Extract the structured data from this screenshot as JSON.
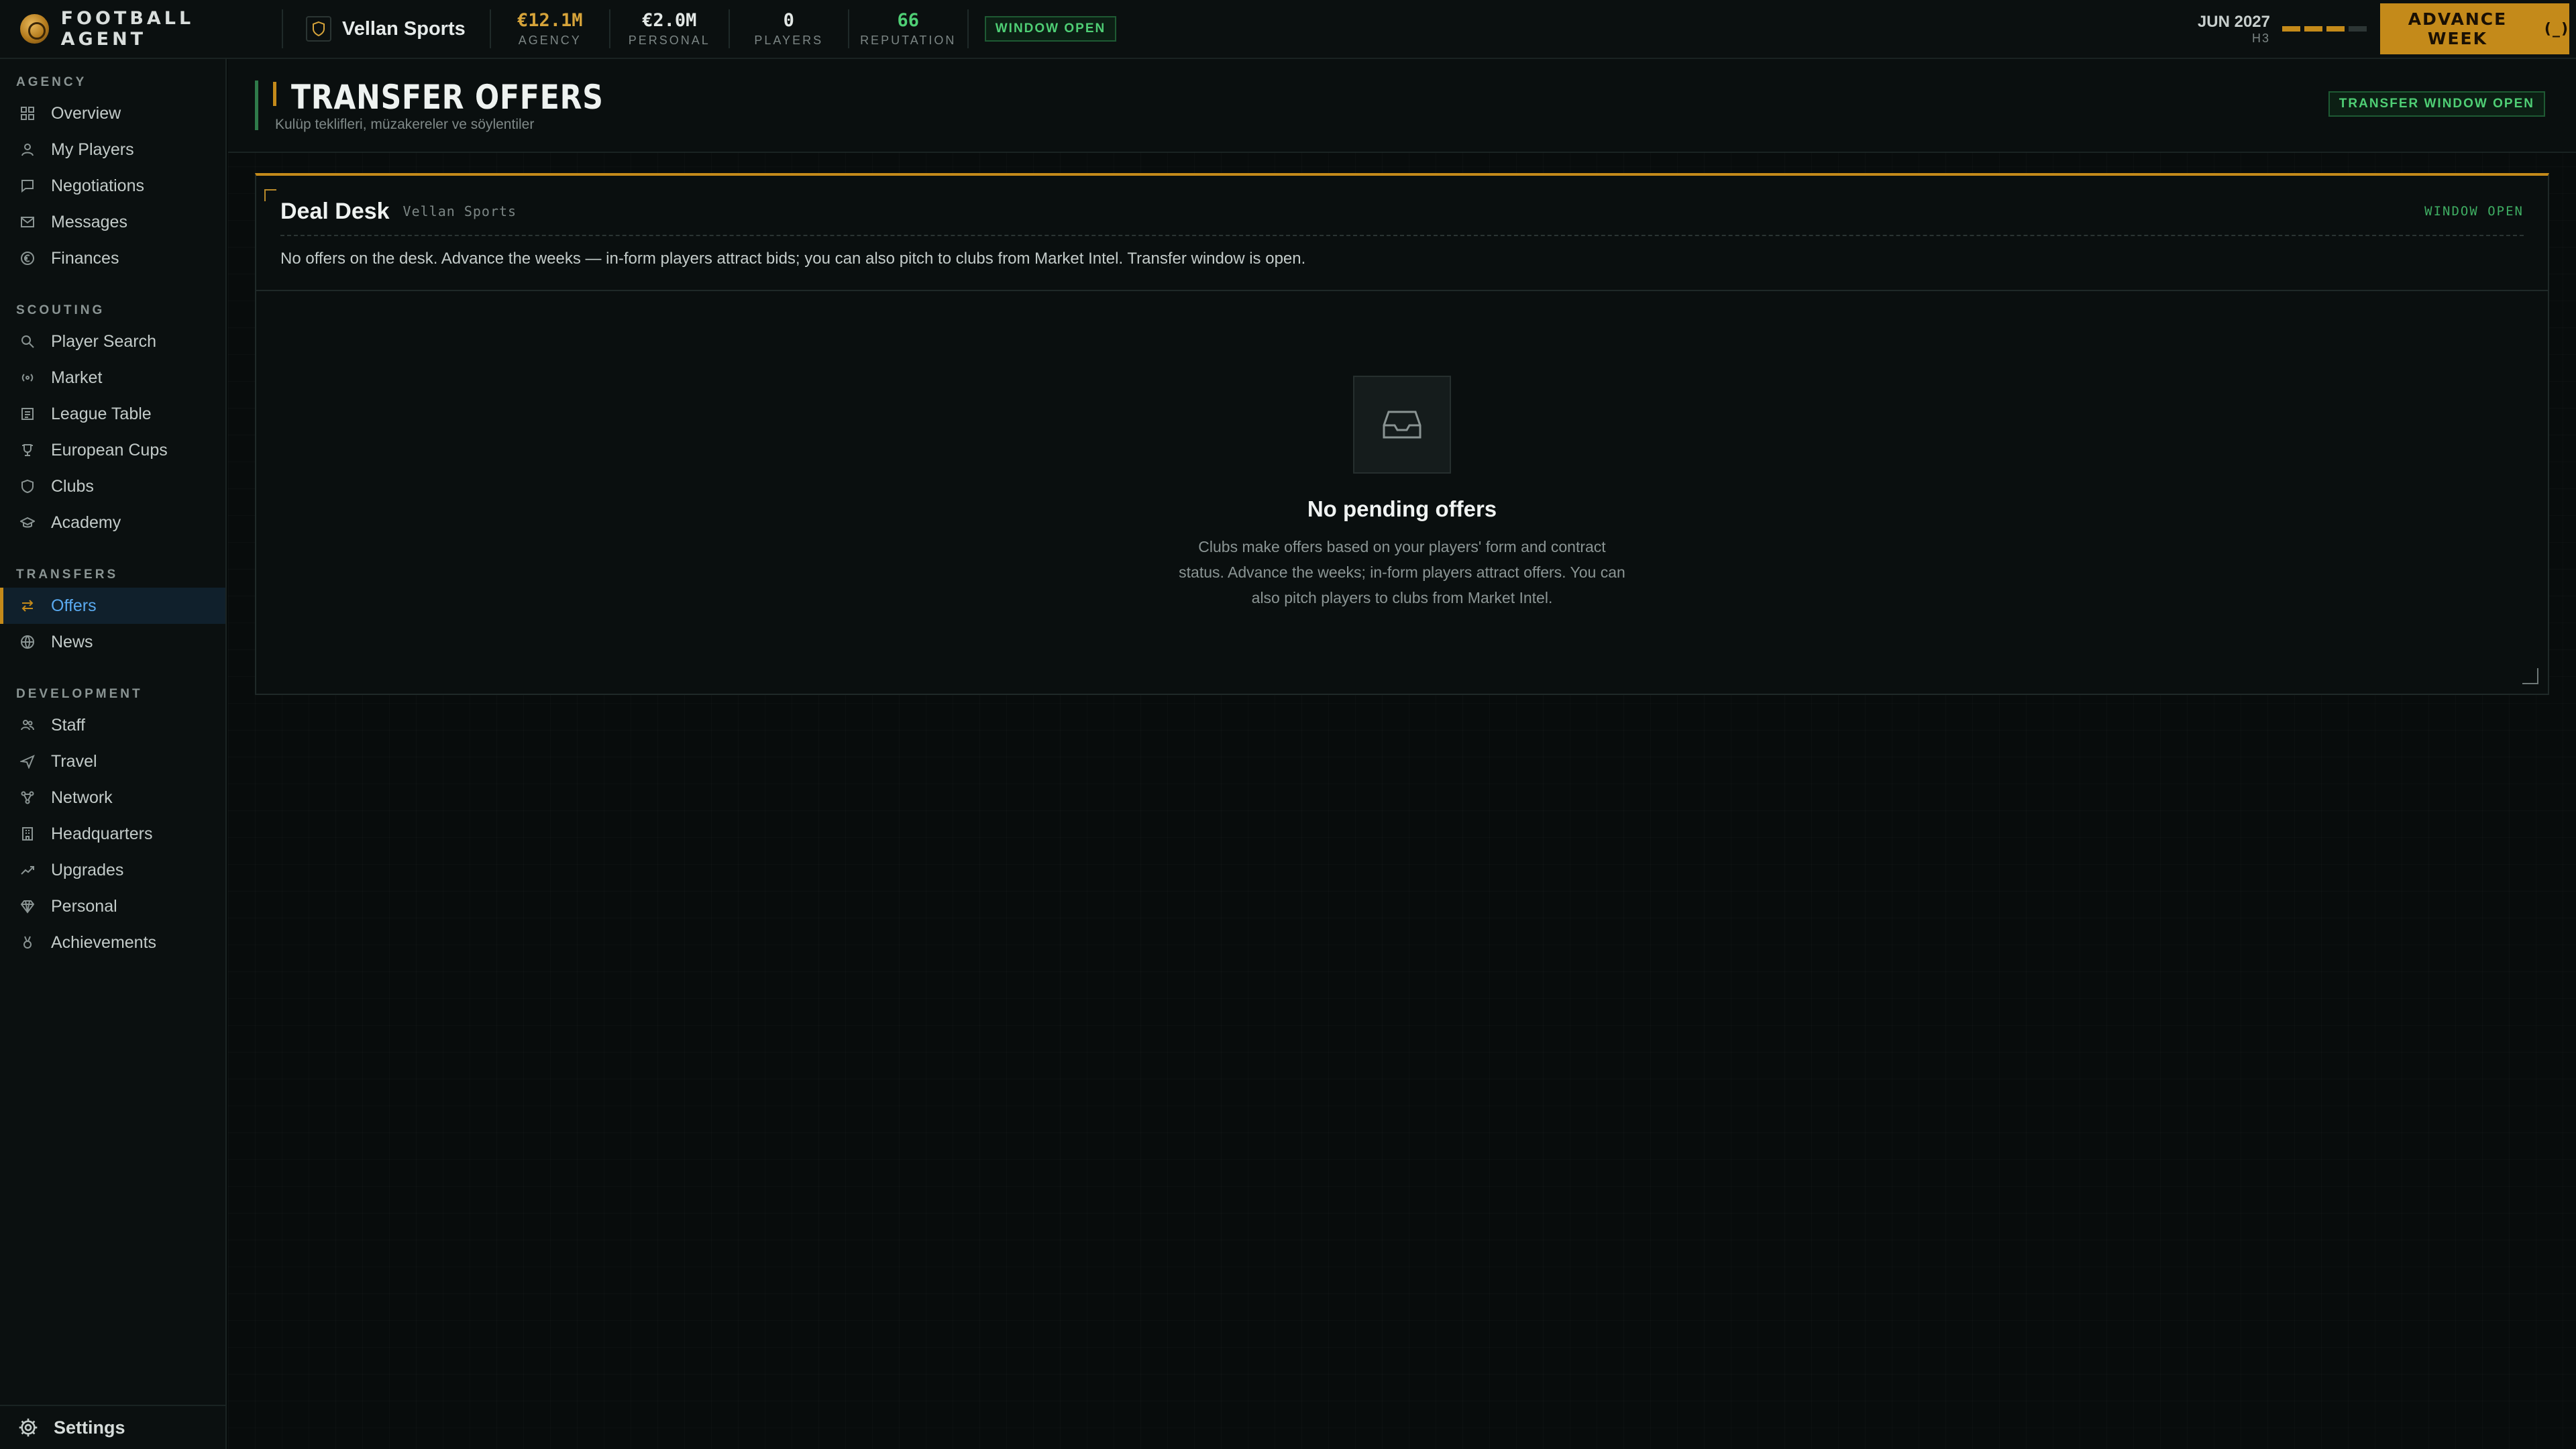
{
  "app": {
    "brand": "FOOTBALL AGENT",
    "club": "Vellan Sports"
  },
  "stats": [
    {
      "value": "€12.1M",
      "label": "AGENCY",
      "color": "#d7a43a"
    },
    {
      "value": "€2.0M",
      "label": "PERSONAL",
      "color": "#e3e8e6"
    },
    {
      "value": "0",
      "label": "PLAYERS",
      "color": "#e3e8e6"
    },
    {
      "value": "66",
      "label": "REPUTATION",
      "color": "#4fcf75"
    }
  ],
  "window_badge": "WINDOW OPEN",
  "date": {
    "main": "JUN 2027",
    "sub": "H3",
    "progress_filled": 3,
    "progress_total": 4
  },
  "advance": {
    "label": "ADVANCE WEEK",
    "shortcut": "(_)"
  },
  "sidebar": {
    "sections": [
      {
        "title": "AGENCY",
        "items": [
          {
            "label": "Overview",
            "icon": "grid-icon"
          },
          {
            "label": "My Players",
            "icon": "user-icon"
          },
          {
            "label": "Negotiations",
            "icon": "chat-icon"
          },
          {
            "label": "Messages",
            "icon": "mail-icon"
          },
          {
            "label": "Finances",
            "icon": "euro-icon"
          }
        ]
      },
      {
        "title": "SCOUTING",
        "items": [
          {
            "label": "Player Search",
            "icon": "search-icon"
          },
          {
            "label": "Market",
            "icon": "broadcast-icon"
          },
          {
            "label": "League Table",
            "icon": "table-icon"
          },
          {
            "label": "European Cups",
            "icon": "trophy-icon"
          },
          {
            "label": "Clubs",
            "icon": "shield-icon"
          },
          {
            "label": "Academy",
            "icon": "graduation-icon"
          }
        ]
      },
      {
        "title": "TRANSFERS",
        "items": [
          {
            "label": "Offers",
            "icon": "swap-icon",
            "active": true
          },
          {
            "label": "News",
            "icon": "globe-icon"
          }
        ]
      },
      {
        "title": "DEVELOPMENT",
        "items": [
          {
            "label": "Staff",
            "icon": "users-icon"
          },
          {
            "label": "Travel",
            "icon": "plane-icon"
          },
          {
            "label": "Network",
            "icon": "network-icon"
          },
          {
            "label": "Headquarters",
            "icon": "building-icon"
          },
          {
            "label": "Upgrades",
            "icon": "trend-icon"
          },
          {
            "label": "Personal",
            "icon": "diamond-icon"
          },
          {
            "label": "Achievements",
            "icon": "medal-icon"
          }
        ]
      }
    ],
    "settings": "Settings"
  },
  "page": {
    "title": "TRANSFER OFFERS",
    "subtitle": "Kulüp teklifleri, müzakereler ve söylentiler",
    "badge": "TRANSFER WINDOW OPEN"
  },
  "panel": {
    "title": "Deal Desk",
    "subtitle": "Vellan Sports",
    "tag": "WINDOW OPEN",
    "message": "No offers on the desk. Advance the weeks — in-form players attract bids; you can also pitch to clubs from Market Intel. Transfer window is open.",
    "empty_icon": "inbox-icon",
    "empty_title": "No pending offers",
    "empty_text": "Clubs make offers based on your players' form and contract status. Advance the weeks; in-form players attract offers. You can also pitch players to clubs from Market Intel."
  }
}
